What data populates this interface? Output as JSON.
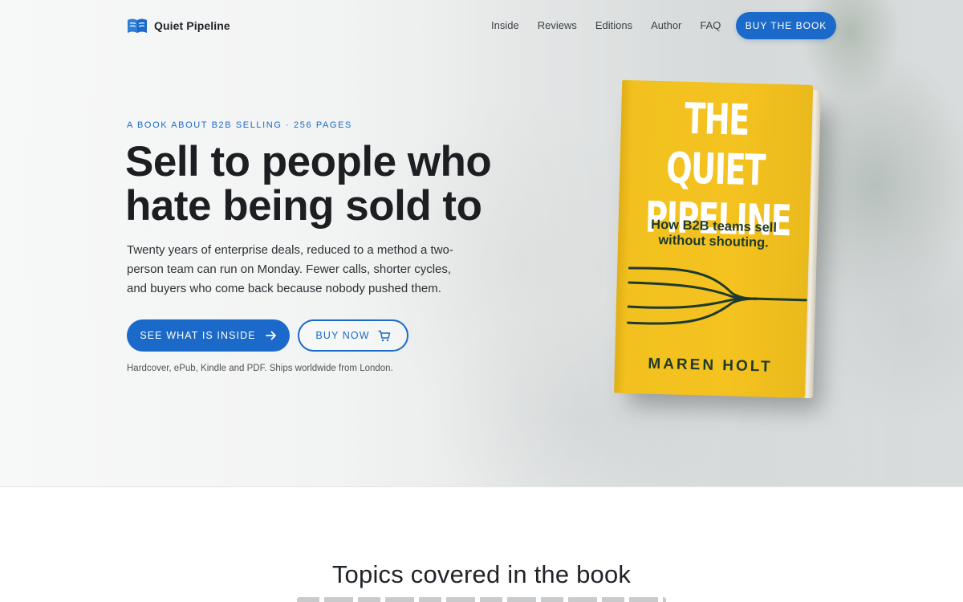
{
  "brand": {
    "name": "Quiet Pipeline",
    "icon": "open-book-icon"
  },
  "nav": {
    "links": [
      "Inside",
      "Reviews",
      "Editions",
      "Author",
      "FAQ"
    ],
    "cta_label": "BUY THE BOOK"
  },
  "hero": {
    "eyebrow": "A BOOK ABOUT B2B SELLING · 256 PAGES",
    "headline": "Sell to people who hate being sold to",
    "lead": "Twenty years of enterprise deals, reduced to a method a two-person team can run on Monday. Fewer calls, shorter cycles, and buyers who come back because nobody pushed them.",
    "primary_cta": {
      "label": "SEE WHAT IS INSIDE",
      "icon": "arrow-right-icon"
    },
    "secondary_cta": {
      "label": "BUY NOW",
      "icon": "cart-icon"
    },
    "formats_note": "Hardcover, ePub, Kindle and PDF. Ships worldwide from London."
  },
  "book_cover": {
    "title_line1": "THE QUIET",
    "title_line2": "PIPELINE",
    "subtitle_line1": "How B2B teams sell",
    "subtitle_line2": "without shouting.",
    "author": "MAREN HOLT"
  },
  "topics": {
    "title": "Topics covered in the book"
  },
  "colors": {
    "accent": "#1b6ac9",
    "cover_yellow": "#f4c320",
    "cover_ink": "#1f3a2c",
    "heading": "#1c1f22"
  }
}
